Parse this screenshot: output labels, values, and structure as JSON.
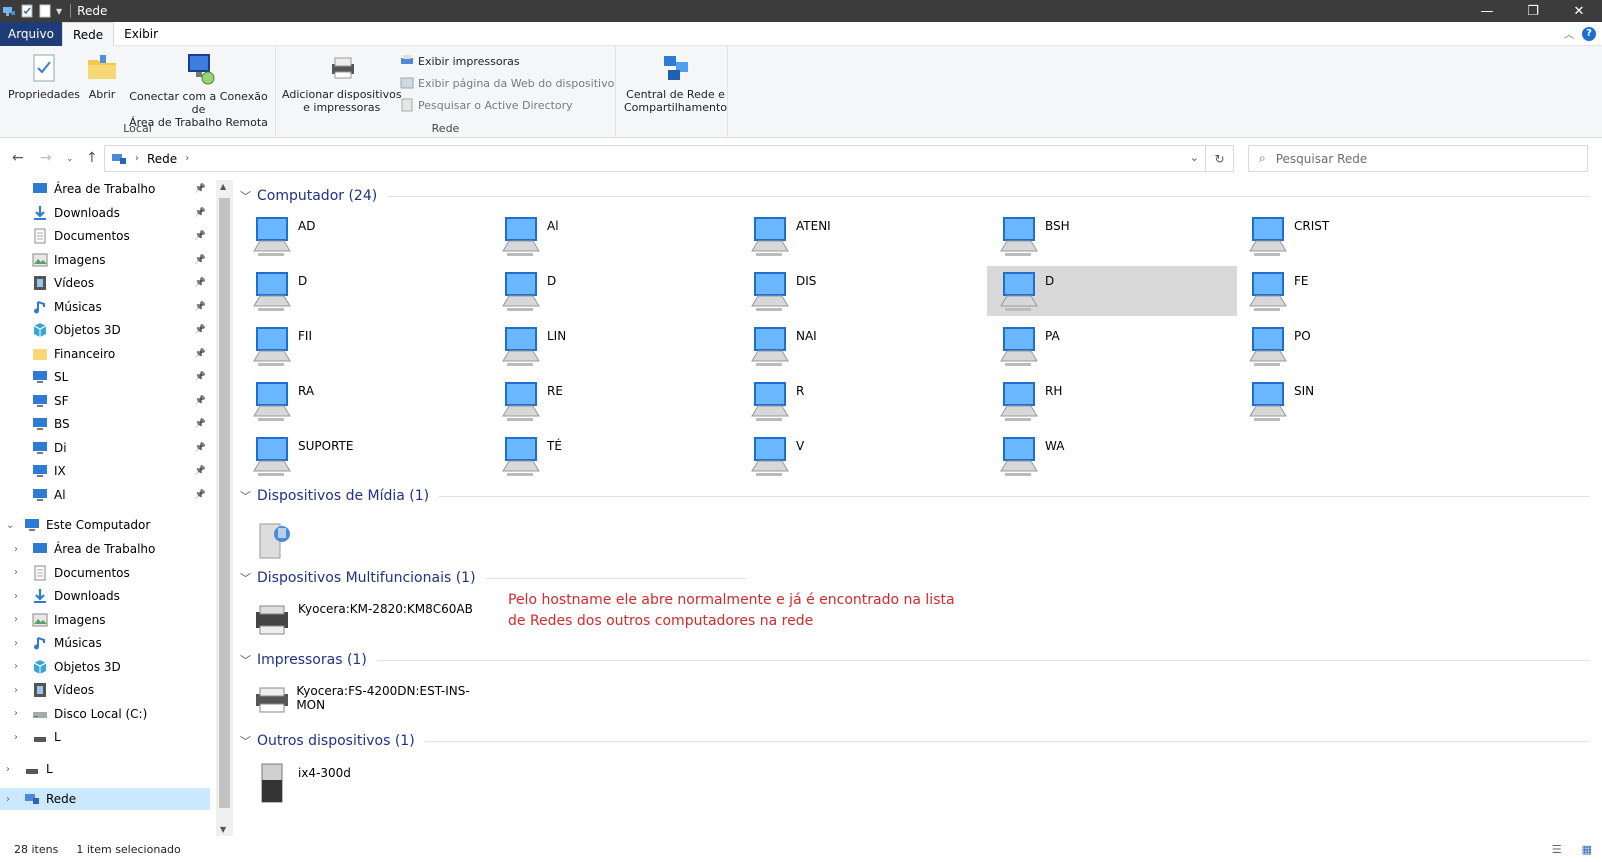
{
  "window": {
    "title": "Rede"
  },
  "ribbon_tabs": [
    "Arquivo",
    "Rede",
    "Exibir"
  ],
  "ribbon": {
    "local_group": "Local",
    "rede_group": "Rede",
    "properties": "Propriedades",
    "open": "Abrir",
    "remote_line1": "Conectar com a Conexão de",
    "remote_line2": "Área de Trabalho Remota",
    "add_devices_line1": "Adicionar dispositivos",
    "add_devices_line2": "e impressoras",
    "show_printers": "Exibir impressoras",
    "show_webpage": "Exibir página da Web do dispositivo",
    "search_ad": "Pesquisar o Active Directory",
    "network_center_line1": "Central de Rede e",
    "network_center_line2": "Compartilhamento"
  },
  "address": {
    "crumb": "Rede",
    "search_placeholder": "Pesquisar Rede"
  },
  "nav": {
    "quick": [
      "Área de Trabalho",
      "Downloads",
      "Documentos",
      "Imagens",
      "Vídeos",
      "Músicas",
      "Objetos 3D",
      "Financeiro",
      "SL",
      "SF",
      "BS",
      "Di",
      "IX",
      "Al"
    ],
    "this_pc": "Este Computador",
    "pc_items": [
      "Área de Trabalho",
      "Documentos",
      "Downloads",
      "Imagens",
      "Músicas",
      "Objetos 3D",
      "Vídeos",
      "Disco Local (C:)",
      "L"
    ],
    "other1": "L",
    "network": "Rede"
  },
  "groups": {
    "computers": "Computador (24)",
    "media": "Dispositivos de Mídia (1)",
    "mfp": "Dispositivos Multifuncionais (1)",
    "printers": "Impressoras (1)",
    "others": "Outros dispositivos (1)"
  },
  "computers": [
    "AD",
    "Al",
    "ATENI",
    "BSH",
    "CRIST",
    "D",
    "D",
    "DIS",
    "D",
    "FE",
    "FII",
    "LIN",
    "NAI",
    "PA",
    "PO",
    "RA",
    "RE",
    "R",
    "RH",
    "SIN",
    "SUPORTE",
    "TÉ",
    "V",
    "WA"
  ],
  "media_device": "",
  "mfp_device": "Kyocera:KM-2820:KM8C60AB",
  "printer_device": "Kyocera:FS-4200DN:EST-INS-MON",
  "other_device": "ix4-300d",
  "annotation": "Pelo hostname ele abre normalmente e já é encontrado na lista de Redes dos outros computadores na rede",
  "status": {
    "count": "28 itens",
    "selected": "1 item selecionado"
  },
  "colors": {
    "accent": "#1e3287",
    "file_tab": "#1f3c78",
    "note": "#d42a2a",
    "selection": "#d9d9d9"
  }
}
